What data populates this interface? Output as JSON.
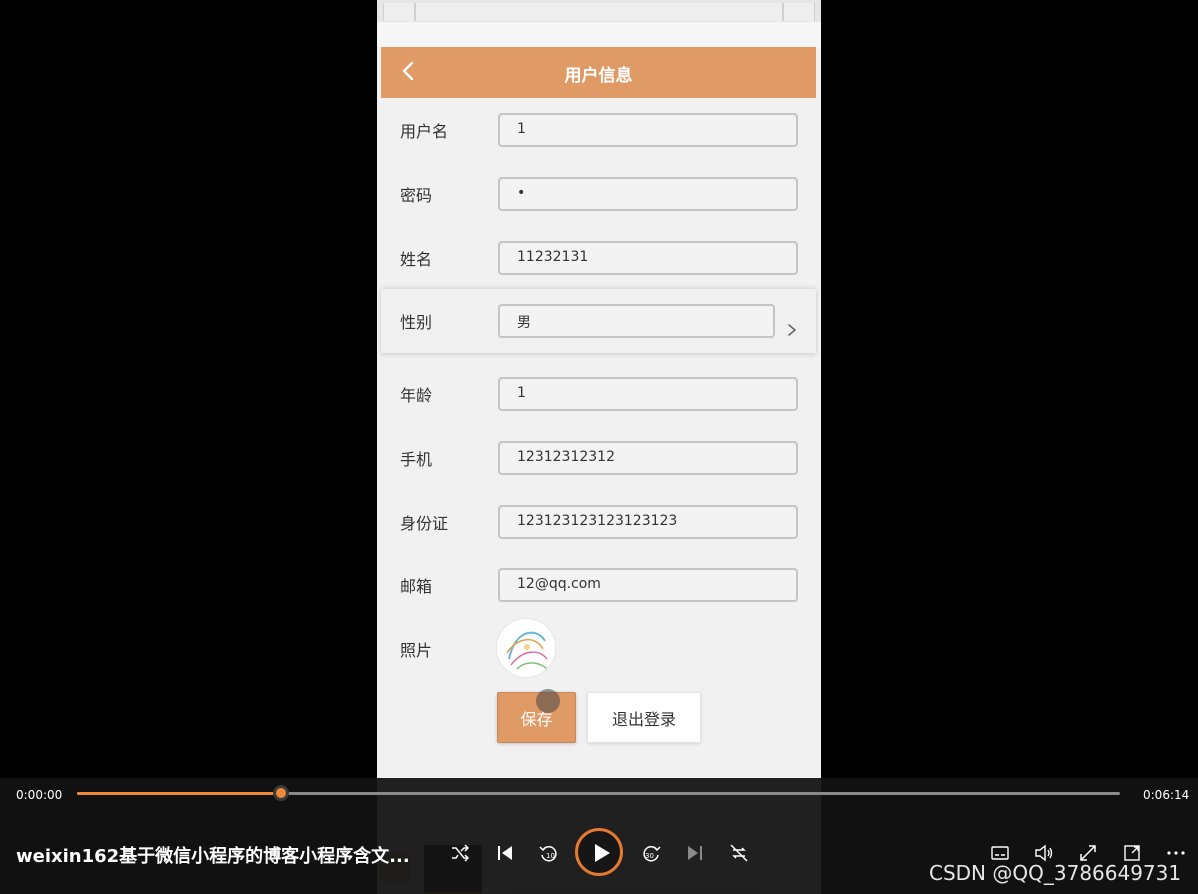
{
  "header": {
    "title": "用户信息"
  },
  "form": {
    "fields": [
      {
        "label": "用户名",
        "value": "1"
      },
      {
        "label": "密码",
        "value": "•"
      },
      {
        "label": "姓名",
        "value": "11232131"
      },
      {
        "label": "性别",
        "value": "男"
      },
      {
        "label": "年龄",
        "value": "1"
      },
      {
        "label": "手机",
        "value": "12312312312"
      },
      {
        "label": "身份证",
        "value": "123123123123123123"
      },
      {
        "label": "邮箱",
        "value": "12@qq.com"
      }
    ],
    "photo_label": "照片",
    "save_label": "保存",
    "logout_label": "退出登录"
  },
  "player": {
    "current_time": "0:00:00",
    "total_time": "0:06:14",
    "progress": 0.196,
    "title": "weixin162基于微信小程序的博客小程序含文...",
    "watermark": "CSDN @QQ_3786649731",
    "accent_color": "#f08a39",
    "icons": [
      "shuffle-icon",
      "previous-icon",
      "rewind-10-icon",
      "play-icon",
      "forward-30-icon",
      "next-icon",
      "repeat-off-icon",
      "subtitles-icon",
      "volume-icon",
      "fullscreen-icon",
      "mini-player-icon",
      "more-icon"
    ]
  },
  "theme": {
    "header_color": "#df9a66"
  }
}
